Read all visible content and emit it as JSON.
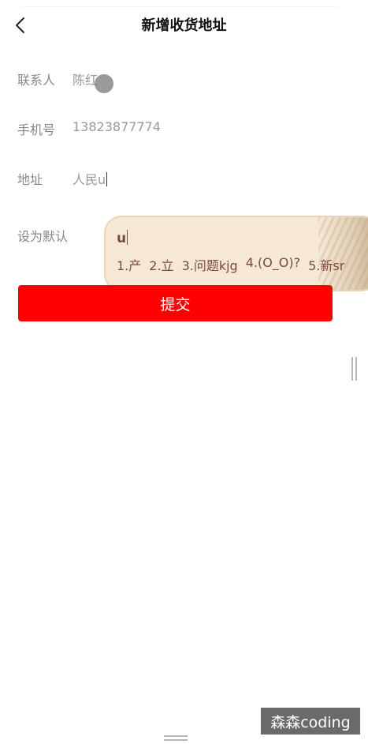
{
  "header": {
    "title": "新增收货地址",
    "back_icon": "chevron-left-icon"
  },
  "form": {
    "contact": {
      "label": "联系人",
      "value": "陈红"
    },
    "phone": {
      "label": "手机号",
      "value": "13823877774"
    },
    "address": {
      "label": "地址",
      "value": "人民u"
    },
    "default": {
      "label": "设为默认"
    }
  },
  "ime": {
    "input": "u",
    "candidates": [
      "1.产",
      "2.立",
      "3.问题kjg",
      "4.(O_O)?",
      "5.新sr"
    ]
  },
  "submit": {
    "label": "提交",
    "color": "#ff0000"
  },
  "watermark": {
    "text": "森森coding"
  }
}
